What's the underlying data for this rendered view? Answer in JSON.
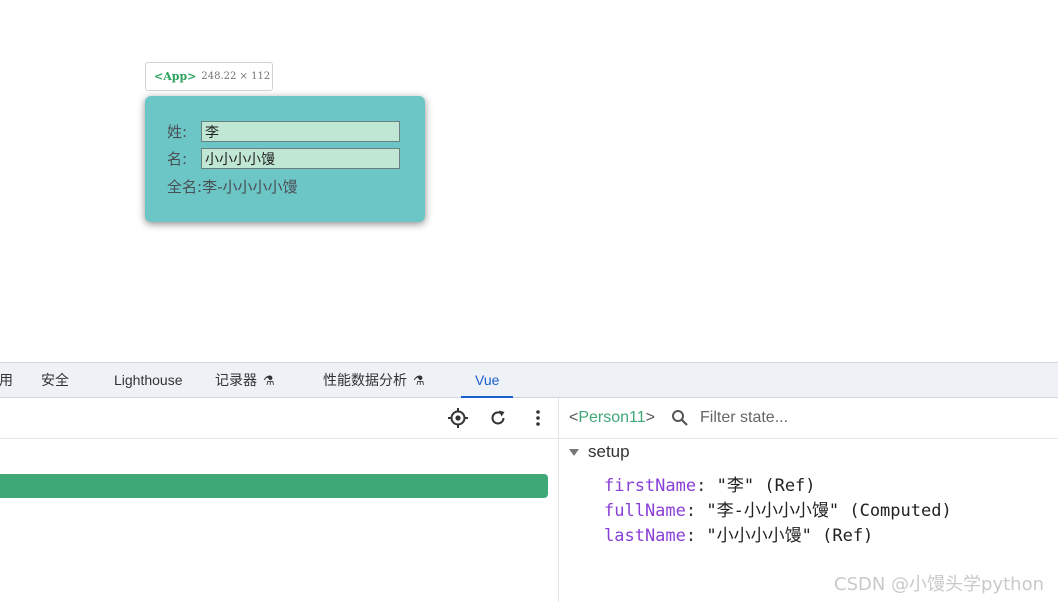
{
  "preview": {
    "inspect_tag": {
      "name": "<App>",
      "size": "248.22 × 112"
    },
    "form": {
      "first_label": "姓:",
      "first_value": "李",
      "last_label": "名:",
      "last_value": "小小小小馒",
      "full_label": "全名:",
      "full_value": "李-小小小小馒"
    }
  },
  "devtools": {
    "tabs": [
      {
        "label": "用"
      },
      {
        "label": "安全"
      },
      {
        "label": "Lighthouse"
      },
      {
        "label": "记录器",
        "icon": "flask-icon"
      },
      {
        "label": "性能数据分析",
        "icon": "flask-icon"
      },
      {
        "label": "Vue",
        "active": true
      }
    ],
    "toolbar_icons": [
      "target-icon",
      "refresh-icon",
      "more-vert-icon"
    ],
    "inspector": {
      "component": "<Person11>",
      "component_open": "<",
      "component_name": "Person11",
      "component_close": ">",
      "filter_placeholder": "Filter state...",
      "section_label": "setup",
      "props": [
        {
          "key": "firstName",
          "value": "\"李\"",
          "type": "(Ref)"
        },
        {
          "key": "fullName",
          "value": "\"李-小小小小馒\"",
          "type": "(Computed)"
        },
        {
          "key": "lastName",
          "value": "\"小小小小馒\"",
          "type": "(Ref)"
        }
      ]
    }
  },
  "watermark": "CSDN @小馒头学python",
  "colors": {
    "accent_green": "#3ea877",
    "card_bg": "#6dc6c6",
    "active_tab": "#1a5fd0",
    "prop_key": "#8a3fd6"
  }
}
